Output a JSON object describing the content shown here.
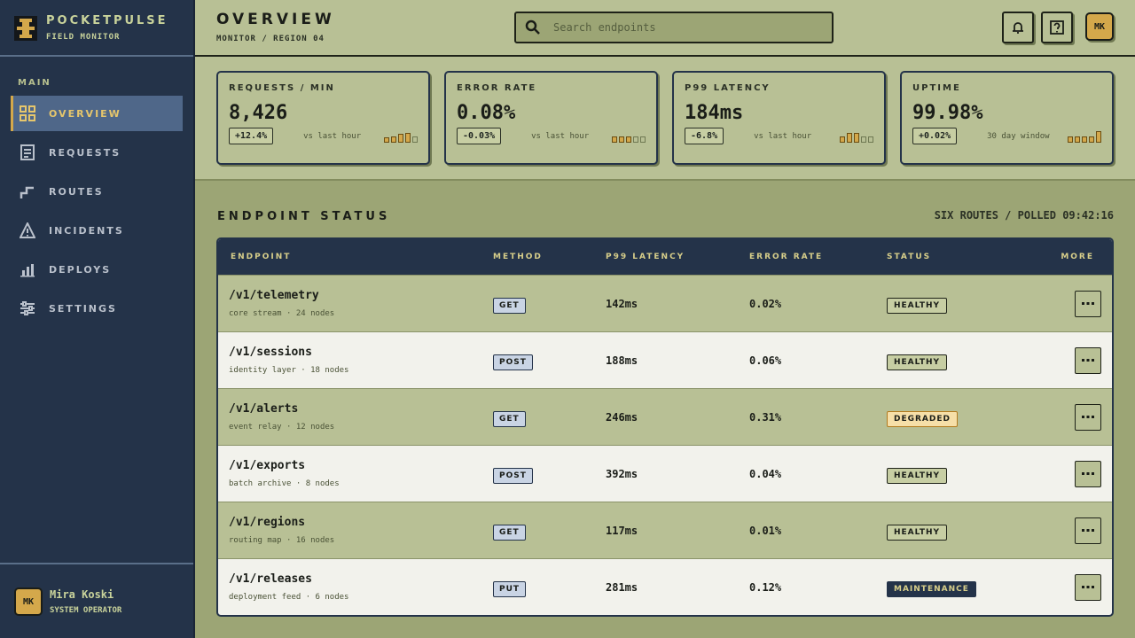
{
  "brand": {
    "name": "POCKETPULSE",
    "subtitle": "FIELD MONITOR"
  },
  "sidebar": {
    "section": "MAIN",
    "items": [
      {
        "label": "OVERVIEW",
        "icon": "grid-icon",
        "active": true
      },
      {
        "label": "REQUESTS",
        "icon": "document-icon"
      },
      {
        "label": "ROUTES",
        "icon": "route-icon"
      },
      {
        "label": "INCIDENTS",
        "icon": "warning-icon"
      },
      {
        "label": "DEPLOYS",
        "icon": "bar-chart-icon"
      },
      {
        "label": "SETTINGS",
        "icon": "sliders-icon"
      }
    ],
    "user": {
      "initials": "MK",
      "name": "Mira Koski",
      "role": "SYSTEM OPERATOR"
    }
  },
  "header": {
    "title": "OVERVIEW",
    "breadcrumb": "MONITOR / REGION 04",
    "search_placeholder": "Search endpoints",
    "avatar_initials": "MK"
  },
  "stats": [
    {
      "label": "REQUESTS / MIN",
      "value": "8,426",
      "delta": "+12.4%",
      "note": "vs last hour",
      "bars": [
        0.4,
        0.5,
        0.7,
        0.8,
        0.5
      ],
      "on": [
        true,
        true,
        true,
        true,
        false
      ]
    },
    {
      "label": "ERROR RATE",
      "value": "0.08%",
      "delta": "-0.03%",
      "note": "vs last hour",
      "bars": [
        0.5,
        0.5,
        0.5,
        0.5,
        0.5
      ],
      "on": [
        true,
        true,
        true,
        false,
        false
      ]
    },
    {
      "label": "P99 LATENCY",
      "value": "184ms",
      "delta": "-6.8%",
      "note": "vs last hour",
      "bars": [
        0.5,
        0.8,
        0.8,
        0.5,
        0.5
      ],
      "on": [
        true,
        true,
        true,
        false,
        false
      ]
    },
    {
      "label": "UPTIME",
      "value": "99.98%",
      "delta": "+0.02%",
      "note": "30 day window",
      "bars": [
        0.5,
        0.5,
        0.5,
        0.5,
        0.9
      ],
      "on": [
        true,
        true,
        true,
        true,
        true
      ]
    }
  ],
  "endpoints": {
    "title": "ENDPOINT STATUS",
    "meta": "SIX ROUTES / POLLED 09:42:16",
    "columns": [
      "ENDPOINT",
      "METHOD",
      "P99 LATENCY",
      "ERROR RATE",
      "STATUS",
      "MORE"
    ],
    "rows": [
      {
        "path": "/v1/telemetry",
        "sub": "core stream · 24 nodes",
        "method": "GET",
        "latency": "142ms",
        "error": "0.02%",
        "status": "HEALTHY"
      },
      {
        "path": "/v1/sessions",
        "sub": "identity layer · 18 nodes",
        "method": "POST",
        "latency": "188ms",
        "error": "0.06%",
        "status": "HEALTHY"
      },
      {
        "path": "/v1/alerts",
        "sub": "event relay · 12 nodes",
        "method": "GET",
        "latency": "246ms",
        "error": "0.31%",
        "status": "DEGRADED"
      },
      {
        "path": "/v1/exports",
        "sub": "batch archive · 8 nodes",
        "method": "POST",
        "latency": "392ms",
        "error": "0.04%",
        "status": "HEALTHY"
      },
      {
        "path": "/v1/regions",
        "sub": "routing map · 16 nodes",
        "method": "GET",
        "latency": "117ms",
        "error": "0.01%",
        "status": "HEALTHY"
      },
      {
        "path": "/v1/releases",
        "sub": "deployment feed · 6 nodes",
        "method": "PUT",
        "latency": "281ms",
        "error": "0.12%",
        "status": "MAINTENANCE"
      }
    ]
  },
  "colors": {
    "accent": "#d4a84b",
    "sidebar": "#243349",
    "panel": "#b8c095",
    "degraded": "#f6dfa8"
  }
}
